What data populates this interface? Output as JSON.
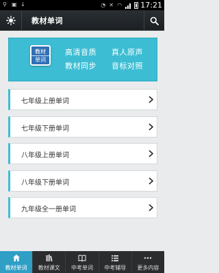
{
  "status_bar": {
    "time": "17:21"
  },
  "header": {
    "title": "教材单词",
    "left_icon": "sun-icon",
    "right_icon": "search-icon"
  },
  "banner": {
    "book_line1": "教材",
    "book_line2": "单词",
    "features": [
      "高清音质",
      "真人原声",
      "教材同步",
      "音标对照"
    ]
  },
  "list": {
    "items": [
      {
        "label": "七年级上册单词"
      },
      {
        "label": "七年级下册单词"
      },
      {
        "label": "八年级上册单词"
      },
      {
        "label": "八年级下册单词"
      },
      {
        "label": "九年级全一册单词"
      }
    ]
  },
  "nav": {
    "tabs": [
      {
        "label": "教材单词",
        "icon": "home-icon",
        "active": true
      },
      {
        "label": "教材课文",
        "icon": "books-icon",
        "active": false
      },
      {
        "label": "中考单词",
        "icon": "open-book-icon",
        "active": false
      },
      {
        "label": "中考辅导",
        "icon": "list-icon",
        "active": false
      },
      {
        "label": "更多内容",
        "icon": "more-icon",
        "active": false
      }
    ]
  },
  "colors": {
    "accent": "#3dbdd3",
    "nav_active": "#2f9fc6",
    "header_bg": "#1c2023",
    "page_bg": "#e9ebec"
  }
}
